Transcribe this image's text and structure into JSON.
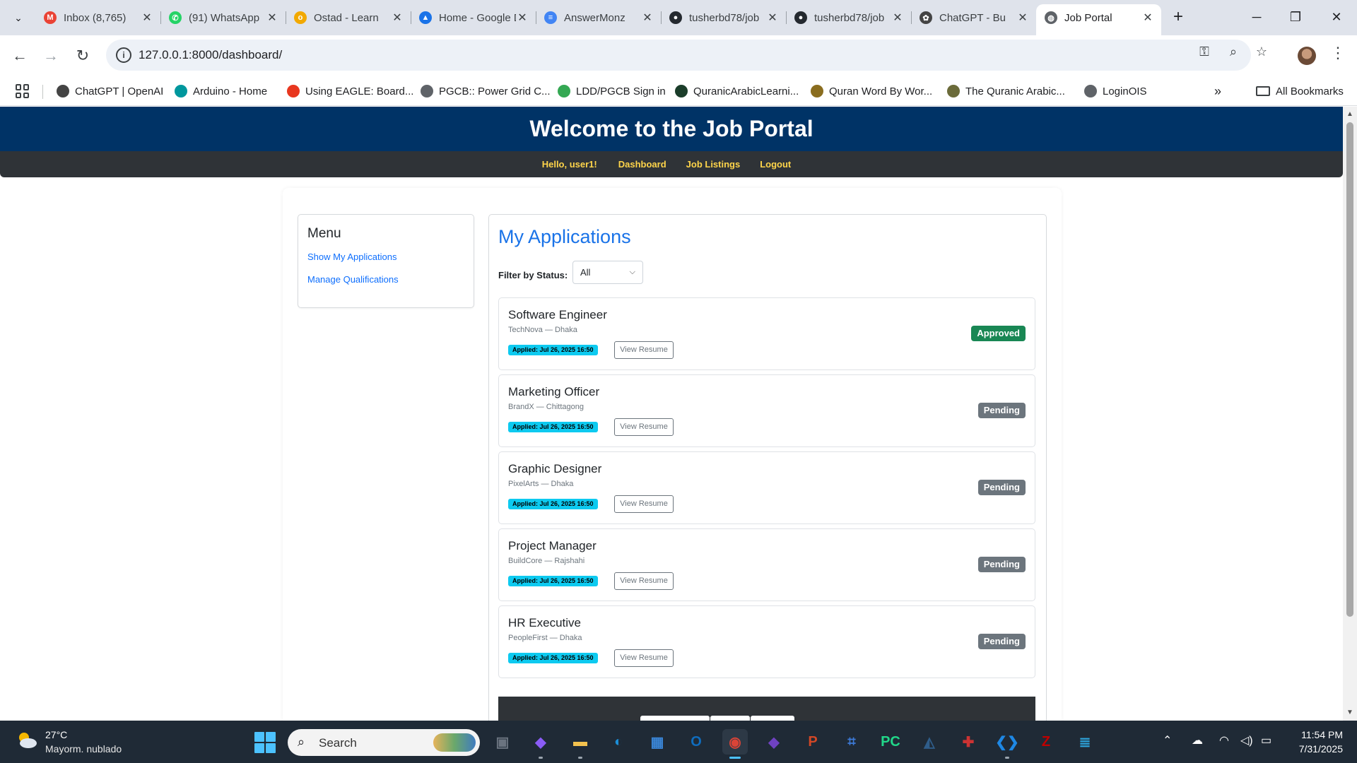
{
  "browser": {
    "tabs": [
      {
        "title": "Inbox (8,765)",
        "icon": "gmail-icon",
        "color": "#ea4335",
        "glyph": "M"
      },
      {
        "title": "(91) WhatsApp",
        "icon": "whatsapp-icon",
        "color": "#25d366",
        "glyph": "✆"
      },
      {
        "title": "Ostad - Learn",
        "icon": "ostad-icon",
        "color": "#f2a900",
        "glyph": "o"
      },
      {
        "title": "Home - Google Drive",
        "icon": "google-drive-icon",
        "color": "#1a73e8",
        "glyph": "▲"
      },
      {
        "title": "AnswerMonz",
        "icon": "docs-icon",
        "color": "#4285f4",
        "glyph": "≡"
      },
      {
        "title": "tusherbd78/job",
        "icon": "github-icon",
        "color": "#24292f",
        "glyph": "●"
      },
      {
        "title": "tusherbd78/job",
        "icon": "github-icon",
        "color": "#24292f",
        "glyph": "●"
      },
      {
        "title": "ChatGPT - Bu",
        "icon": "chatgpt-icon",
        "color": "#444444",
        "glyph": "✿"
      },
      {
        "title": "Job Portal",
        "icon": "globe-icon",
        "color": "#5f6368",
        "glyph": "◍"
      }
    ],
    "url": "127.0.0.1:8000/dashboard/",
    "bookmarks": [
      {
        "label": "ChatGPT | OpenAI",
        "icon": "chatgpt-icon",
        "color": "#444444"
      },
      {
        "label": "Arduino - Home",
        "icon": "arduino-icon",
        "color": "#00979d"
      },
      {
        "label": "Using EAGLE: Board...",
        "icon": "eagle-icon",
        "color": "#e8371f"
      },
      {
        "label": "PGCB:: Power Grid C...",
        "icon": "globe-icon",
        "color": "#5f6368"
      },
      {
        "label": "LDD/PGCB Sign in",
        "icon": "play-icon",
        "color": "#34a853"
      },
      {
        "label": "QuranicArabicLearni...",
        "icon": "quranic-icon",
        "color": "#1b3d2a"
      },
      {
        "label": "Quran Word By Wor...",
        "icon": "quran-q-icon",
        "color": "#8a6d1f"
      },
      {
        "label": "The Quranic Arabic...",
        "icon": "book-icon",
        "color": "#6b6b3a"
      },
      {
        "label": "LoginOIS",
        "icon": "globe-icon",
        "color": "#5f6368"
      }
    ],
    "all_bookmarks": "All Bookmarks"
  },
  "site": {
    "header": "Welcome to the Job Portal",
    "hello": "Hello, user1!",
    "nav": [
      "Dashboard",
      "Job Listings",
      "Logout"
    ]
  },
  "menu": {
    "title": "Menu",
    "links": [
      "Show My Applications",
      "Manage Qualifications"
    ]
  },
  "applications": {
    "title": "My Applications",
    "filter_label": "Filter by Status:",
    "filter_value": "All",
    "resume_label": "View Resume",
    "items": [
      {
        "title": "Software Engineer",
        "company": "TechNova — Dhaka",
        "applied": "Applied: Jul 26, 2025 16:50",
        "status": "Approved"
      },
      {
        "title": "Marketing Officer",
        "company": "BrandX — Chittagong",
        "applied": "Applied: Jul 26, 2025 16:50",
        "status": "Pending"
      },
      {
        "title": "Graphic Designer",
        "company": "PixelArts — Dhaka",
        "applied": "Applied: Jul 26, 2025 16:50",
        "status": "Pending"
      },
      {
        "title": "Project Manager",
        "company": "BuildCore — Rajshahi",
        "applied": "Applied: Jul 26, 2025 16:50",
        "status": "Pending"
      },
      {
        "title": "HR Executive",
        "company": "PeopleFirst — Dhaka",
        "applied": "Applied: Jul 26, 2025 16:50",
        "status": "Pending"
      }
    ]
  },
  "taskbar": {
    "temperature": "27°C",
    "weather": "Mayorm. nublado",
    "search": "Search",
    "time": "11:54 PM",
    "date": "7/31/2025",
    "apps": [
      {
        "icon": "task-view-icon",
        "color": "#6b7480",
        "glyph": "▣"
      },
      {
        "icon": "copilot-icon",
        "color": "#8a5cf6",
        "glyph": "◆"
      },
      {
        "icon": "file-explorer-icon",
        "color": "#f2c14e",
        "glyph": "▬"
      },
      {
        "icon": "edge-icon",
        "color": "#1b8fd8",
        "glyph": "◐"
      },
      {
        "icon": "microsoft-store-icon",
        "color": "#3a86d8",
        "glyph": "▦"
      },
      {
        "icon": "outlook-icon",
        "color": "#0f6cbd",
        "glyph": "O"
      },
      {
        "icon": "chrome-icon",
        "color": "#db4437",
        "glyph": "◉"
      },
      {
        "icon": "microsoft-365-icon",
        "color": "#6f42c1",
        "glyph": "◆"
      },
      {
        "icon": "powerpoint-icon",
        "color": "#d24726",
        "glyph": "P"
      },
      {
        "icon": "network-tool-icon",
        "color": "#3d7bd9",
        "glyph": "⌗"
      },
      {
        "icon": "pycharm-icon",
        "color": "#21d789",
        "glyph": "PC"
      },
      {
        "icon": "mysql-workbench-icon",
        "color": "#2f5d8a",
        "glyph": "◭"
      },
      {
        "icon": "paint-tool-icon",
        "color": "#c33",
        "glyph": "✚"
      },
      {
        "icon": "vscode-icon",
        "color": "#1e88e5",
        "glyph": "❮❯"
      },
      {
        "icon": "filezilla-icon",
        "color": "#bf0000",
        "glyph": "Z"
      },
      {
        "icon": "notepad-icon",
        "color": "#2ea2d8",
        "glyph": "≣"
      }
    ]
  }
}
